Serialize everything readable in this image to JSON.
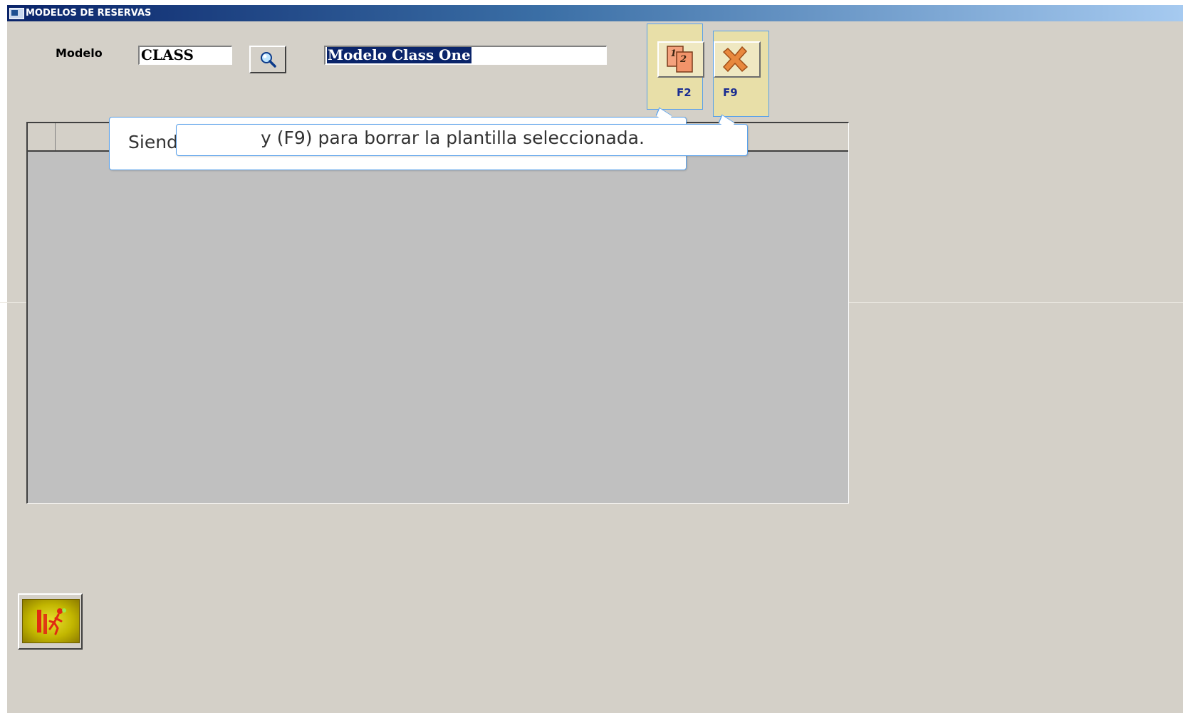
{
  "window": {
    "title": "MODELOS DE RESERVAS"
  },
  "form": {
    "modelo_label": "Modelo",
    "modelo_code": "CLASS",
    "modelo_description_selected": "Modelo Class One"
  },
  "toolbar": {
    "f2_label": "F2",
    "f9_label": "F9",
    "f2_icon": "copy-pages-icon",
    "f9_icon": "delete-x-icon",
    "search_icon": "magnifier-icon"
  },
  "tooltips": {
    "back_text": "Siend",
    "front_text": "y (F9) para borrar la plantilla seleccionada."
  },
  "footer": {
    "exit_icon": "exit-running-man-icon"
  },
  "colors": {
    "title_start": "#0a246a",
    "title_end": "#a6caf0",
    "window_bg": "#d4d0c8",
    "grid_bg": "#c0c0c0",
    "fkey_bg": "#e8dfa8",
    "fkey_text": "#1b2d91",
    "tooltip_border": "#58a0ea"
  }
}
